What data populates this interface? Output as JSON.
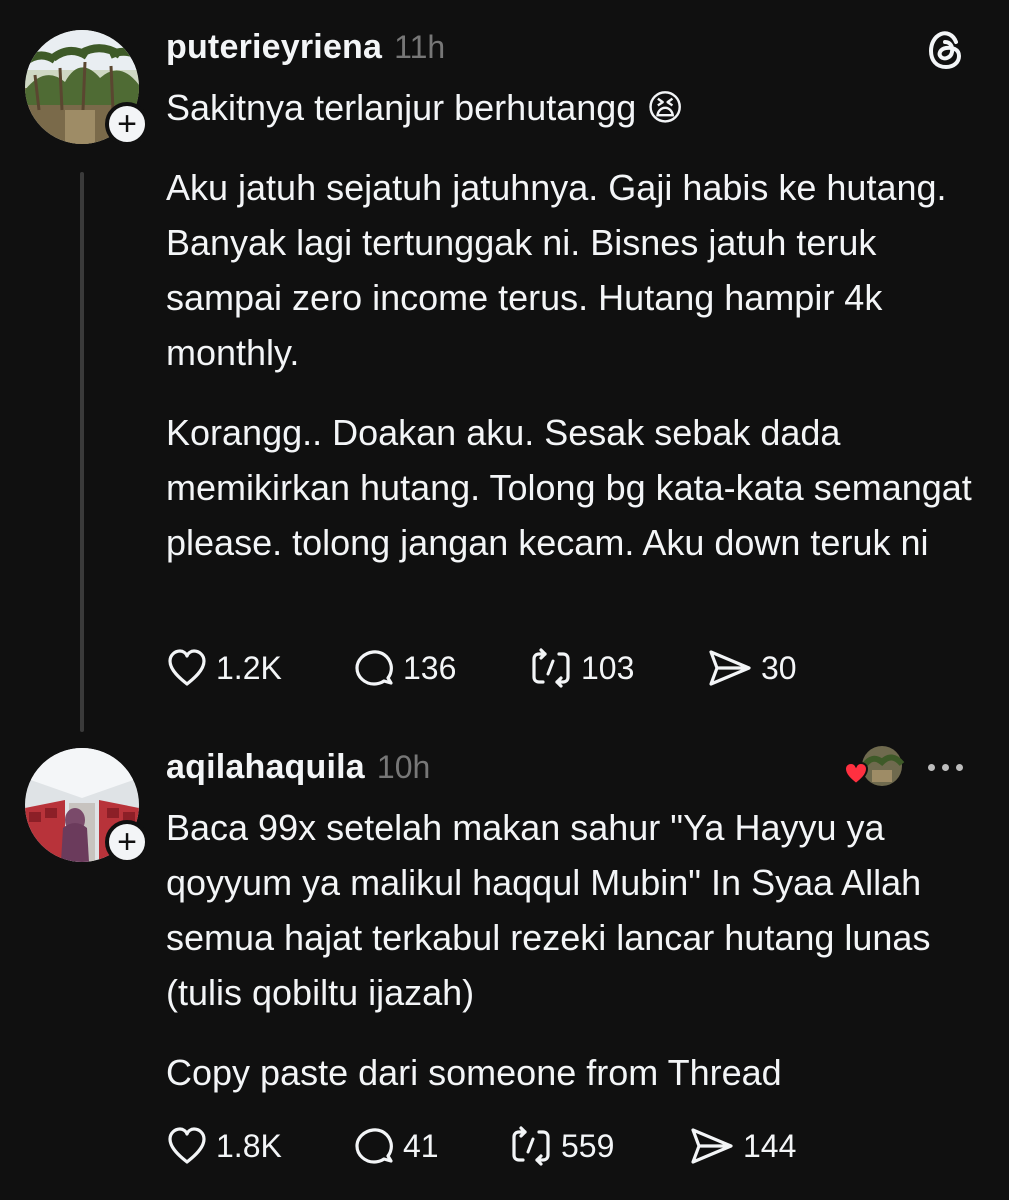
{
  "posts": [
    {
      "username": "puterieyriena",
      "time": "11h",
      "title": "Sakitnya terlanjur berhutangg",
      "title_emoji": "😫",
      "paragraphs": [
        "Aku jatuh sejatuh jatuhnya. Gaji habis ke hutang. Banyak lagi tertunggak ni. Bisnes jatuh teruk sampai zero income terus. Hutang hampir 4k monthly.",
        "Korangg.. Doakan aku. Sesak sebak dada memikirkan hutang. Tolong bg kata-kata semangat please. tolong jangan kecam. Aku down teruk ni"
      ],
      "likes": "1.2K",
      "replies": "136",
      "reposts": "103",
      "shares": "30"
    },
    {
      "username": "aqilahaquila",
      "time": "10h",
      "paragraphs": [
        "Baca 99x setelah makan sahur \"Ya Hayyu ya qoyyum ya malikul haqqul Mubin\" In Syaa Allah semua hajat terkabul rezeki lancar hutang lunas (tulis qobiltu ijazah)",
        "Copy paste dari someone from Thread"
      ],
      "likes": "1.8K",
      "replies": "41",
      "reposts": "559",
      "shares": "144"
    }
  ],
  "follow_glyph": "+",
  "icons": {
    "like": "heart-icon",
    "reply": "comment-bubble-icon",
    "repost": "repost-icon",
    "share": "send-icon",
    "app": "threads-logo-icon",
    "more": "more-dots-icon",
    "liked_by": "liked-by-author-icon"
  },
  "colors": {
    "background": "#101010",
    "text": "#f3f5f7",
    "muted": "#777777",
    "heart": "#ff3040"
  }
}
